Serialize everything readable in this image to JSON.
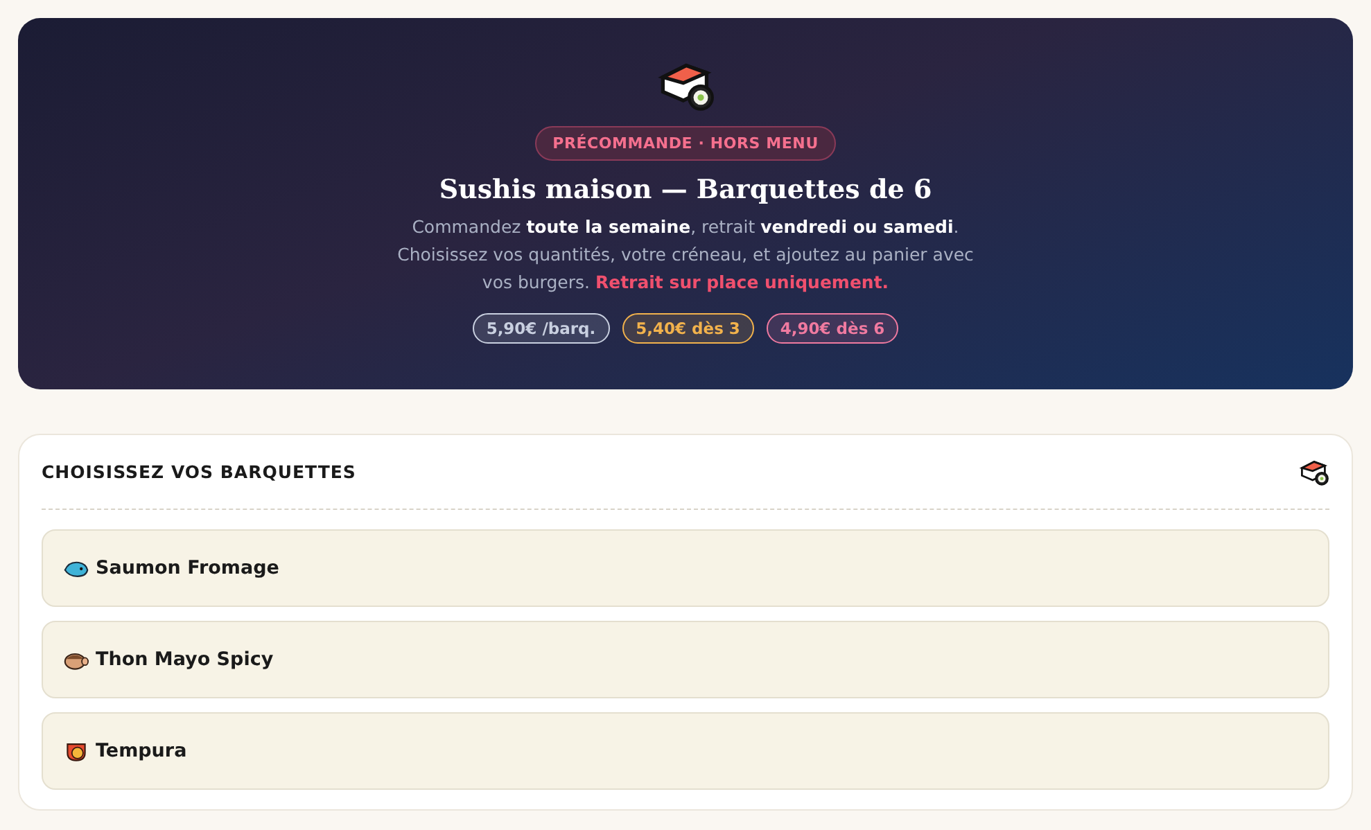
{
  "hero": {
    "badge": "PRÉCOMMANDE · HORS MENU",
    "title": "Sushis maison — Barquettes de 6",
    "description": "Commandez **toute la semaine**, retrait **vendredi ou samedi**. Choisissez vos quantités, votre créneau, et ajoutez au panier avec vos burgers.",
    "notice": "Retrait sur place uniquement.",
    "prices": [
      {
        "label": "5,90€ /barq.",
        "color": "#c9d0e0"
      },
      {
        "label": "5,40€ dès 3",
        "color": "#f2b24c"
      },
      {
        "label": "4,90€ dès 6",
        "color": "#f07aa0"
      }
    ]
  },
  "section": {
    "title": "CHOISISSEZ VOS BARQUETTES",
    "items": [
      {
        "kind": "salmon",
        "name": "Saumon Fromage"
      },
      {
        "kind": "tuna",
        "name": "Thon Mayo Spicy"
      },
      {
        "kind": "tempura",
        "name": "Tempura"
      }
    ]
  }
}
